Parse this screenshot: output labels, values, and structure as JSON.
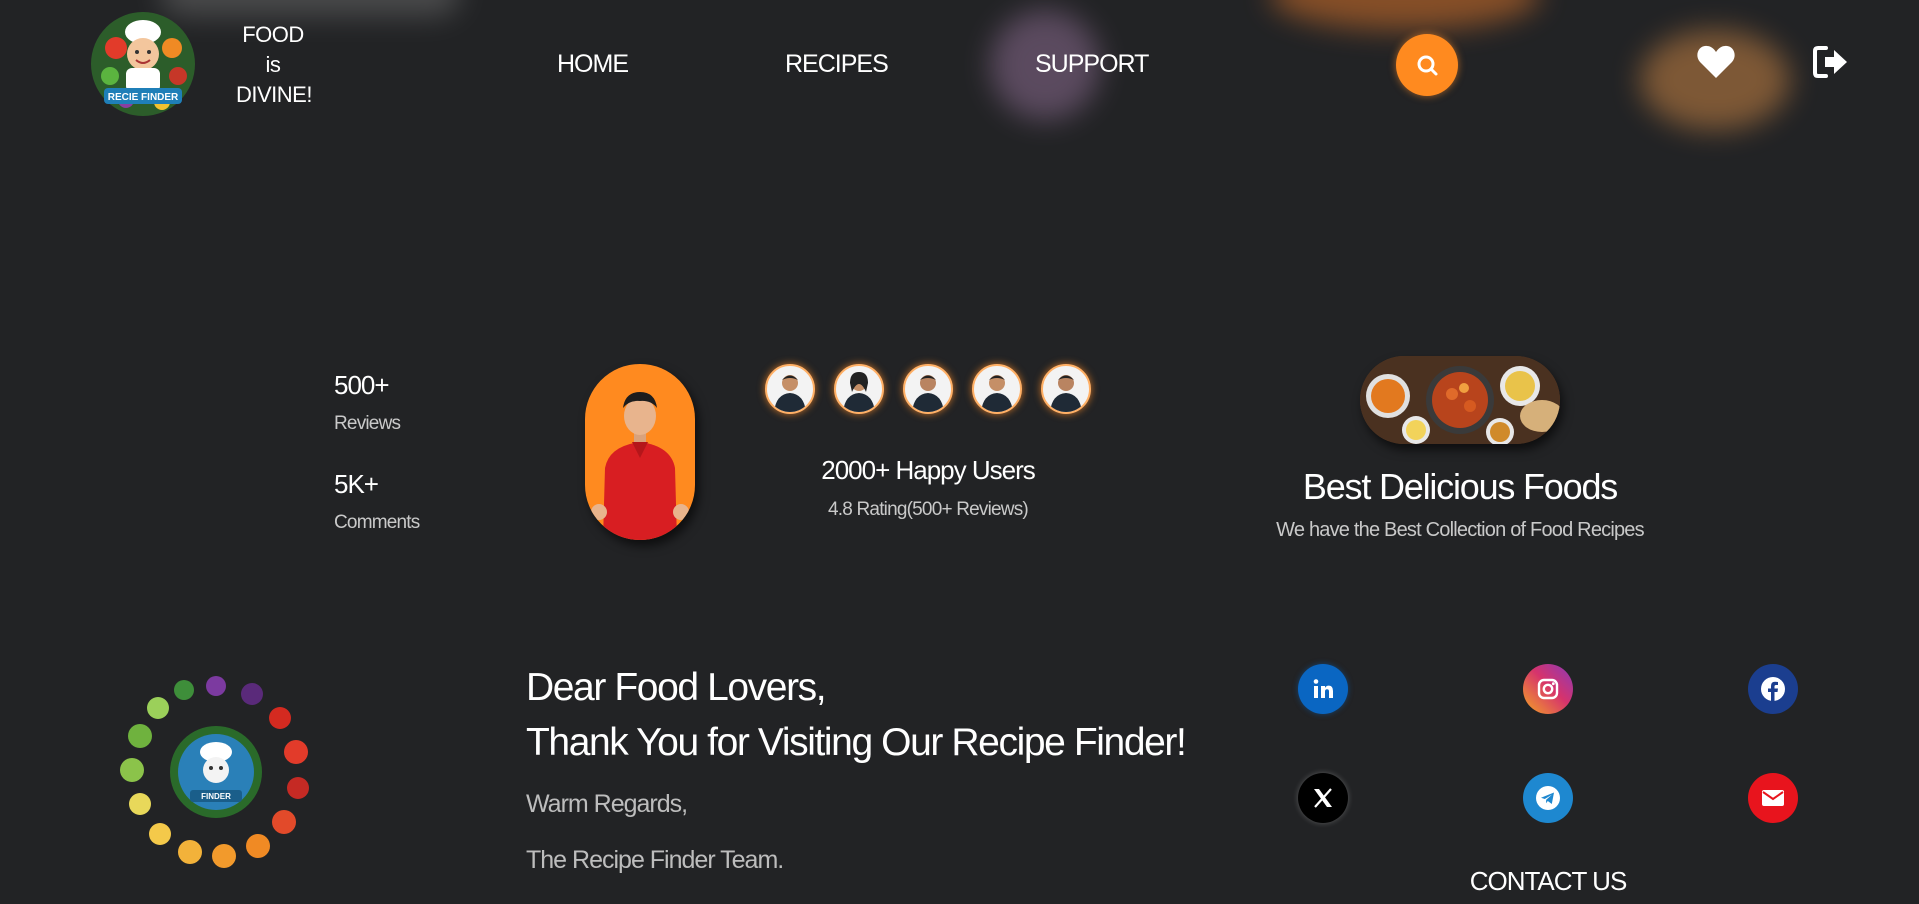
{
  "header": {
    "tagline_lines": [
      "FOOD",
      "is",
      "DIVINE!"
    ],
    "logo_banner_text": "RECIE FINDER",
    "nav": [
      "HOME",
      "RECIPES",
      "SUPPORT"
    ],
    "accent_color": "#ff8a1f"
  },
  "stats": {
    "reviews_value": "500+",
    "reviews_label": "Reviews",
    "comments_value": "5K+",
    "comments_label": "Comments",
    "happy_users": "2000+ Happy Users",
    "rating": "4.8 Rating(500+ Reviews)",
    "best_title": "Best Delicious Foods",
    "best_subtitle": "We have the Best Collection of Food Recipes"
  },
  "footer": {
    "greeting": "Dear Food Lovers,",
    "thanks": "Thank You for Visiting Our Recipe Finder!",
    "regards": "Warm Regards,",
    "team": "The Recipe Finder Team.",
    "contact": "CONTACT US",
    "wreath_text": "FINDER",
    "socials": [
      {
        "icon": "linkedin-icon",
        "color": "#0a66c2"
      },
      {
        "icon": "instagram-icon",
        "color": "#d6336c"
      },
      {
        "icon": "facebook-icon",
        "color": "#1b3e8f"
      },
      {
        "icon": "x-icon",
        "color": "#000000"
      },
      {
        "icon": "telegram-icon",
        "color": "#1e88d0"
      },
      {
        "icon": "email-icon",
        "color": "#e8141d"
      }
    ]
  }
}
